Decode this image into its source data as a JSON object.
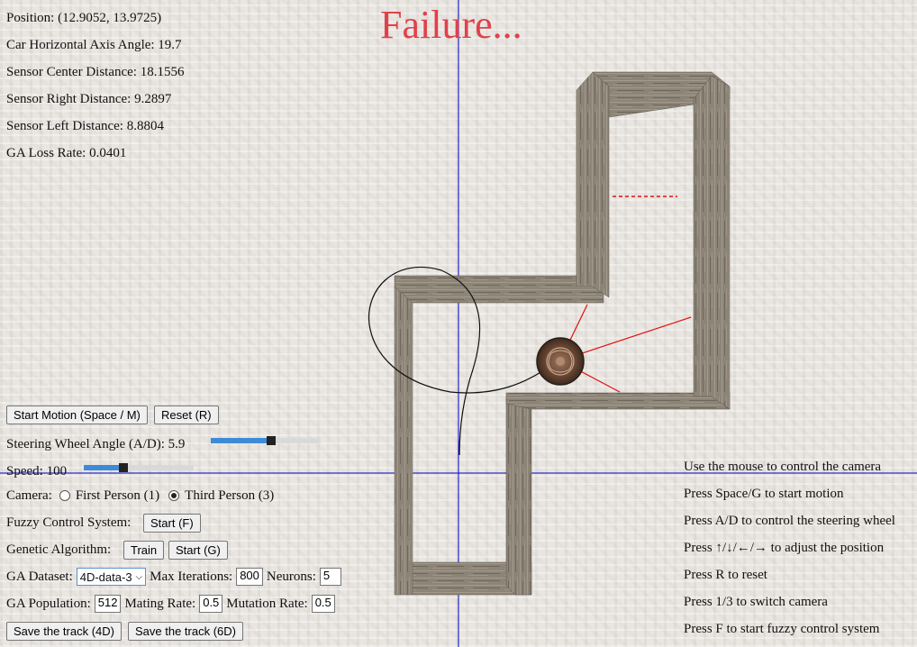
{
  "stats": {
    "position": "Position: (12.9052, 13.9725)",
    "angle": "Car Horizontal Axis Angle: 19.7",
    "center": "Sensor Center Distance: 18.1556",
    "right": "Sensor Right Distance: 9.2897",
    "left": "Sensor Left Distance: 8.8804",
    "ga_loss": "GA Loss Rate: 0.0401"
  },
  "banner": "Failure...",
  "buttons": {
    "start_motion": "Start Motion (Space / M)",
    "reset": "Reset (R)",
    "fuzzy_start": "Start (F)",
    "ga_train": "Train",
    "ga_start": "Start (G)",
    "save_4d": "Save the track (4D)",
    "save_6d": "Save the track (6D)"
  },
  "steering": {
    "label": "Steering Wheel Angle (A/D): 5.9",
    "level": 0.55
  },
  "speed": {
    "label": "Speed: 100",
    "level": 0.35
  },
  "camera": {
    "label": "Camera:",
    "first": "First Person (1)",
    "third": "Third Person (3)",
    "selected": "third"
  },
  "fuzzy": {
    "label": "Fuzzy Control System:"
  },
  "ga": {
    "label": "Genetic Algorithm:",
    "dataset_label": "GA Dataset:",
    "dataset_value": "4D-data-3",
    "iterations_label": "Max Iterations:",
    "iterations_value": "800",
    "neurons_label": "Neurons:",
    "neurons_value": "5",
    "population_label": "GA Population:",
    "population_value": "512",
    "mating_label": "Mating Rate:",
    "mating_value": "0.5",
    "mutation_label": "Mutation Rate:",
    "mutation_value": "0.5"
  },
  "help": [
    "Use the mouse to control the camera",
    "Press Space/G to start motion",
    "Press A/D to control the steering wheel",
    "Press ↑/↓/←/→ to adjust the position",
    "Press R to reset",
    "Press 1/3 to switch camera",
    "Press F to start fuzzy control system"
  ],
  "colors": {
    "banner": "#e0414b",
    "sensor": "#e01010",
    "axis": "#0000cc",
    "wall": "#8a8174",
    "slider_fill": "#3d8bd8"
  }
}
